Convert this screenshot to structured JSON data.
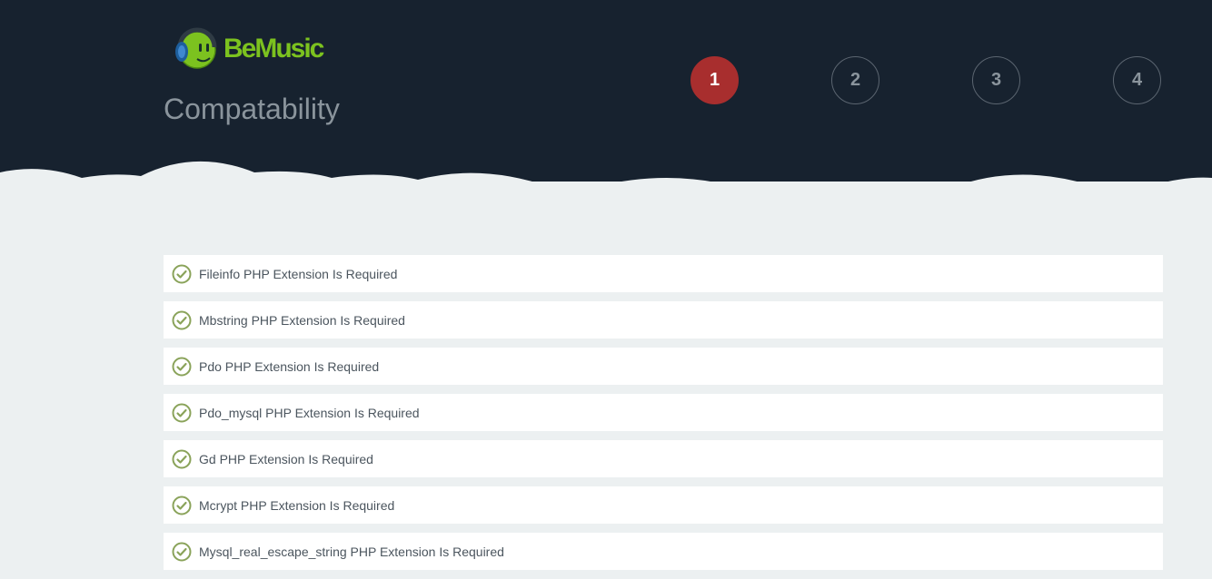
{
  "brand": {
    "name": "BeMusic",
    "color": "#7cc21f",
    "icon": "headphones-smiley-logo-icon"
  },
  "page": {
    "title": "Compatability"
  },
  "steps": [
    {
      "label": "1",
      "active": true
    },
    {
      "label": "2",
      "active": false
    },
    {
      "label": "3",
      "active": false
    },
    {
      "label": "4",
      "active": false
    }
  ],
  "requirements": [
    {
      "text": "Fileinfo PHP Extension Is Required",
      "status": "passed",
      "icon": "check-circle-icon"
    },
    {
      "text": "Mbstring PHP Extension Is Required",
      "status": "passed",
      "icon": "check-circle-icon"
    },
    {
      "text": "Pdo PHP Extension Is Required",
      "status": "passed",
      "icon": "check-circle-icon"
    },
    {
      "text": "Pdo_mysql PHP Extension Is Required",
      "status": "passed",
      "icon": "check-circle-icon"
    },
    {
      "text": "Gd PHP Extension Is Required",
      "status": "passed",
      "icon": "check-circle-icon"
    },
    {
      "text": "Mcrypt PHP Extension Is Required",
      "status": "passed",
      "icon": "check-circle-icon"
    },
    {
      "text": "Mysql_real_escape_string PHP Extension Is Required",
      "status": "passed",
      "icon": "check-circle-icon"
    }
  ],
  "colors": {
    "header_bg": "#17222f",
    "page_bg": "#ecf0f1",
    "active_step": "#a82e2e",
    "check": "#8aa35a"
  }
}
